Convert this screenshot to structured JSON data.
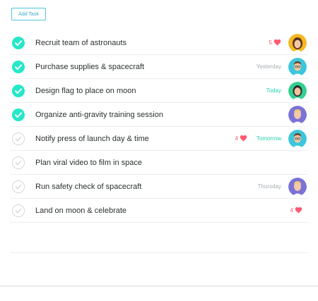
{
  "toolbar": {
    "add_task_label": "Add Task"
  },
  "colors": {
    "accent": "#4ec3dc",
    "check_done": "#25e8c8",
    "like": "#ff5a70",
    "due_today": "#25d0b2",
    "due_default": "#a6adb1"
  },
  "tasks": [
    {
      "title": "Recruit team of astronauts",
      "completed": true,
      "due": "",
      "likes": "5",
      "avatar": "avatar-yellow"
    },
    {
      "title": "Purchase supplies & spacecraft",
      "completed": true,
      "due": "Yesterday",
      "likes": "",
      "avatar": "avatar-teal"
    },
    {
      "title": "Design flag to place on moon",
      "completed": true,
      "due": "Today",
      "likes": "",
      "avatar": "avatar-green"
    },
    {
      "title": "Organize anti-gravity training session",
      "completed": true,
      "due": "",
      "likes": "",
      "avatar": "avatar-purple"
    },
    {
      "title": "Notify press of launch day & time",
      "completed": false,
      "due": "Tomorrow",
      "likes": "4",
      "avatar": "avatar-teal"
    },
    {
      "title": "Plan viral video to film in space",
      "completed": false,
      "due": "",
      "likes": "",
      "avatar": ""
    },
    {
      "title": "Run safety check of spacecraft",
      "completed": false,
      "due": "Thursday",
      "likes": "",
      "avatar": "avatar-purple"
    },
    {
      "title": "Land on moon & celebrate",
      "completed": false,
      "due": "",
      "likes": "4",
      "avatar": ""
    }
  ]
}
